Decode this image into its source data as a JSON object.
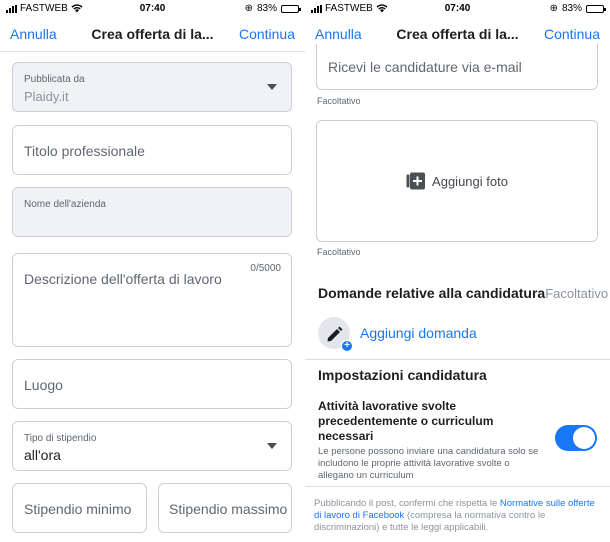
{
  "status": {
    "carrier": "FASTWEB",
    "time": "07:40",
    "battery": "83%",
    "battery_level": 0.83
  },
  "nav": {
    "cancel": "Annulla",
    "title": "Crea offerta di la...",
    "continue": "Continua"
  },
  "left_form": {
    "published_by": {
      "label": "Pubblicata da",
      "value": "Plaidy.it"
    },
    "job_title_placeholder": "Titolo professionale",
    "company_label": "Nome dell'azienda",
    "description": {
      "placeholder": "Descrizione dell'offerta di lavoro",
      "counter": "0/5000"
    },
    "location_placeholder": "Luogo",
    "pay_type": {
      "label": "Tipo di stipendio",
      "value": "all'ora"
    },
    "min_salary_placeholder": "Stipendio minimo",
    "max_salary_placeholder": "Stipendio massimo"
  },
  "right_form": {
    "email_placeholder": "Ricevi le candidature via e-mail",
    "optional_1": "Facoltativo",
    "add_photo": "Aggiungi foto",
    "optional_2": "Facoltativo",
    "questions_title": "Domande relative alla candidatura",
    "questions_optional": "Facoltativo",
    "add_question": "Aggiungi domanda",
    "settings_title": "Impostazioni candidatura",
    "require_experience_title": "Attività lavorative svolte precedentemente o curriculum necessari",
    "require_experience_desc": "Le persone possono inviare una candidatura solo se includono le proprie attività lavorative svolte o allegano un curriculum",
    "require_experience_enabled": true,
    "footer_before": "Pubblicando il post, confermi che rispetta le ",
    "footer_link": "Normative sulle offerte di lavoro di Facebook",
    "footer_after": " (compresa la normativa contro le discriminazioni) e tutte le leggi applicabili."
  }
}
